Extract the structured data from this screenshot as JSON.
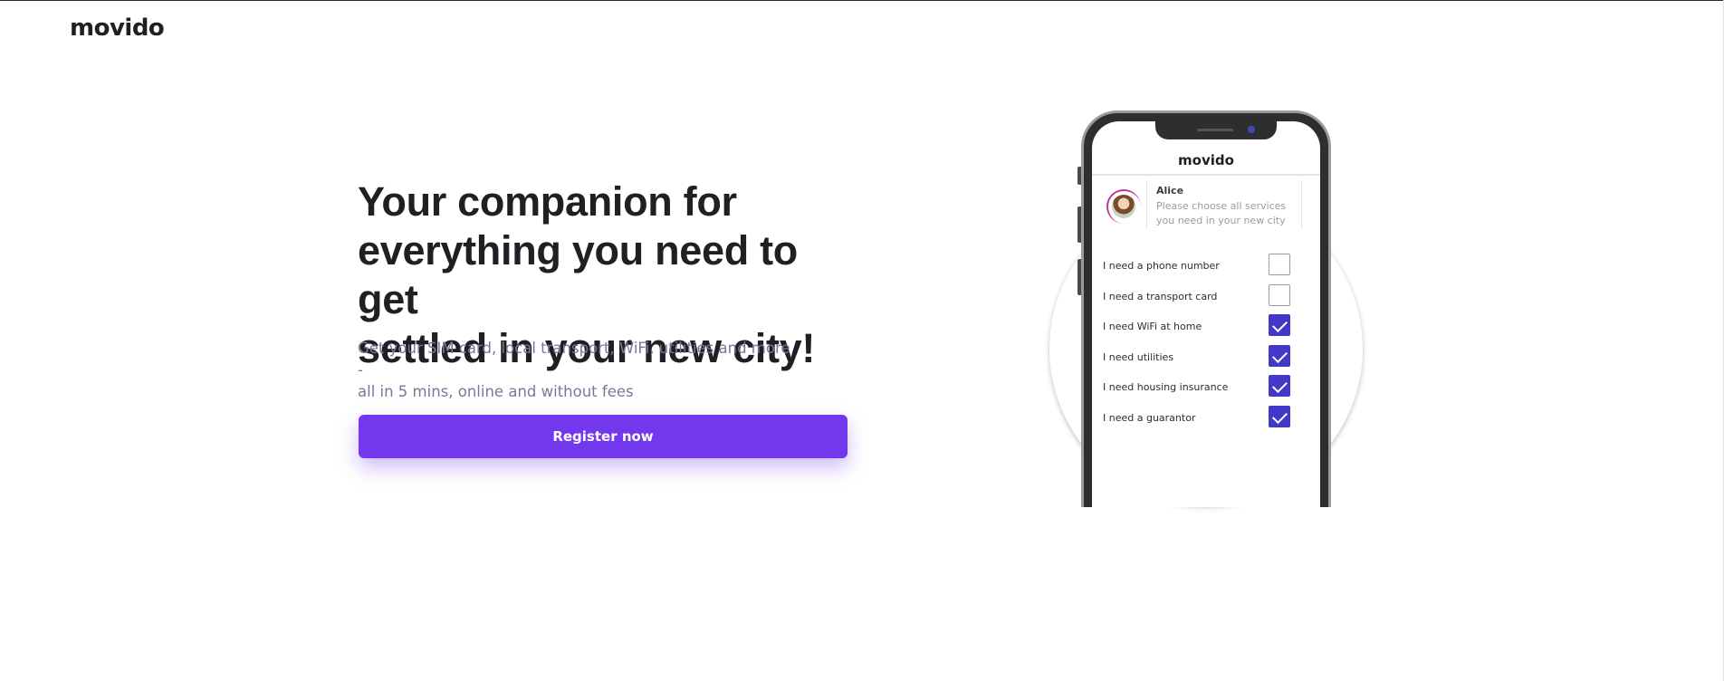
{
  "header": {
    "brand": "movido"
  },
  "hero": {
    "headline_lines": [
      "Your companion for",
      "everything you need to get",
      "settled in your new city!"
    ],
    "subtitle_lines": [
      "Get your SIM card, local transport, WiFi, utilities and more -",
      "all in 5 mins, online and without fees"
    ],
    "cta_label": "Register now"
  },
  "phone": {
    "app_brand": "movido",
    "chat": {
      "name": "Alice",
      "message": "Please choose all services you need in your new city"
    },
    "services": [
      {
        "label": "I need a phone number",
        "checked": false
      },
      {
        "label": "I need a transport card",
        "checked": false
      },
      {
        "label": "I need WiFi at home",
        "checked": true
      },
      {
        "label": "I need utilities",
        "checked": true
      },
      {
        "label": "I need housing insurance",
        "checked": true
      },
      {
        "label": "I need a guarantor",
        "checked": true
      }
    ]
  },
  "colors": {
    "accent": "#7338ee",
    "checkbox_active": "#4239c8",
    "subtitle": "#737c97",
    "heading": "#1f1f24"
  }
}
